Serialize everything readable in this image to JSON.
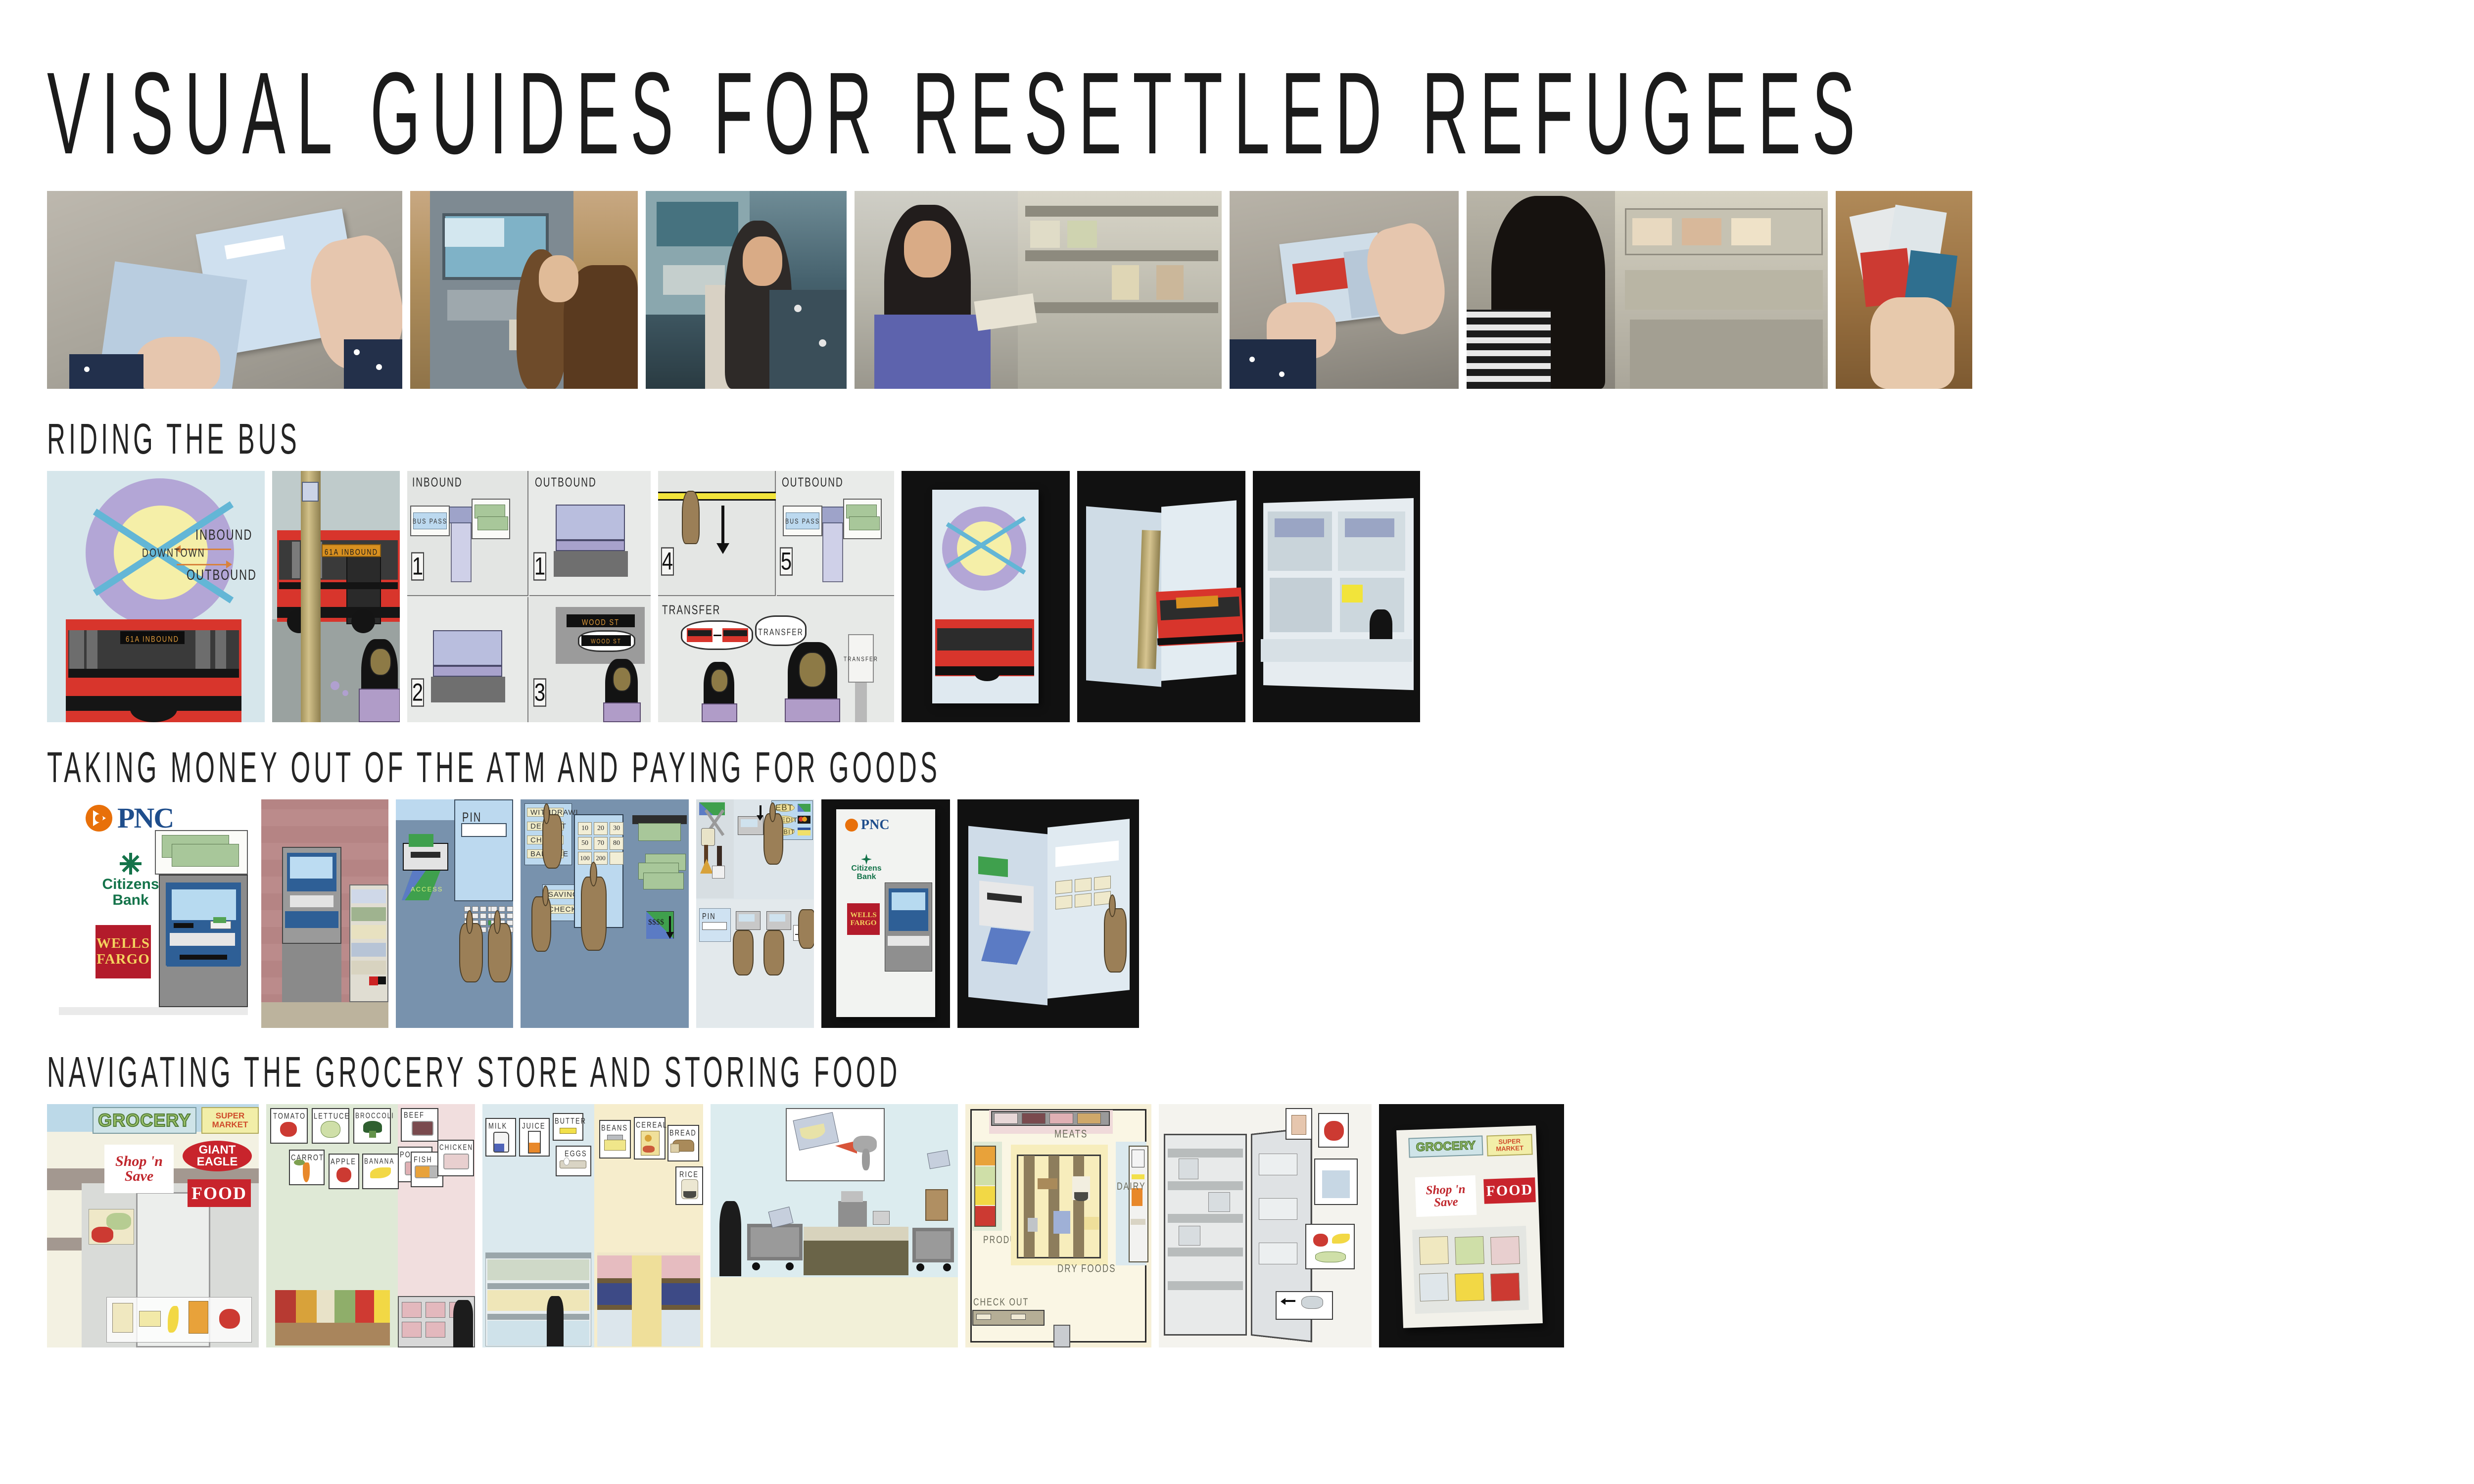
{
  "title": "VISUAL GUIDES FOR RESETTLED REFUGEES",
  "photo_strip": [
    {
      "caption": "hands holding open atm pop-up booklet on sidewalk"
    },
    {
      "caption": "woman using atm machine keypad"
    },
    {
      "caption": "woman on bus holding guide near farebox"
    },
    {
      "caption": "woman reading guide in grocery aisle"
    },
    {
      "caption": "hands holding bus pop-up booklet outdoors"
    },
    {
      "caption": "woman at grocery deli counter"
    },
    {
      "caption": "hands holding stack of guide cards on wood table"
    }
  ],
  "sections": [
    {
      "id": "bus",
      "heading": "RIDING THE BUS",
      "panels": [
        {
          "id": "bus-map",
          "kind": "illustration",
          "labels": [
            "INBOUND",
            "OUTBOUND",
            "DOWNTOWN"
          ],
          "bus_sign": "61A INBOUND"
        },
        {
          "id": "bus-stop",
          "kind": "illustration",
          "bus_sign": "61A INBOUND"
        },
        {
          "id": "board-steps",
          "kind": "illustration",
          "headers": [
            "INBOUND",
            "OUTBOUND"
          ],
          "steps": [
            "1",
            "1",
            "2",
            "3"
          ],
          "signs": [
            "BUS PASS",
            "WOOD ST",
            "WOOD ST"
          ]
        },
        {
          "id": "transfer-steps",
          "kind": "illustration",
          "headers": [
            "OUTBOUND",
            "TRANSFER"
          ],
          "steps": [
            "4",
            "5"
          ],
          "signs": [
            "BUS PASS",
            "TRANSFER",
            "TRANSFER"
          ]
        },
        {
          "id": "bus-book-cover",
          "kind": "photo",
          "caption": "bus guide cover on black"
        },
        {
          "id": "bus-book-open",
          "kind": "photo",
          "caption": "bus pop-up open on black"
        },
        {
          "id": "bus-book-spread",
          "kind": "photo",
          "caption": "bus guide full spread on black"
        }
      ]
    },
    {
      "id": "atm",
      "heading": "TAKING MONEY OUT OF THE ATM AND PAYING FOR GOODS",
      "panels": [
        {
          "id": "banks",
          "kind": "illustration",
          "bank_logos": [
            "PNC",
            "Citizens Bank",
            "WELLS FARGO"
          ]
        },
        {
          "id": "atm-exterior",
          "kind": "illustration"
        },
        {
          "id": "pin-entry",
          "kind": "illustration",
          "labels": [
            "PIN",
            "ACCESS"
          ],
          "keypad_keys": [
            "1",
            "2",
            "3",
            "X",
            "4",
            "5",
            "6",
            "",
            "7",
            "8",
            "9",
            "O",
            "",
            "0",
            "",
            ""
          ]
        },
        {
          "id": "withdraw",
          "kind": "illustration",
          "menu_primary": [
            "WITHDRAWL",
            "DEPOSIT",
            "CHECK",
            "BALANCE"
          ],
          "menu_account": [
            "SAVINGS",
            "CHECKING"
          ],
          "denominations": [
            "10",
            "20",
            "30",
            "50",
            "70",
            "80",
            "100",
            "200"
          ],
          "cash_icon": "$$$$"
        },
        {
          "id": "paying",
          "kind": "illustration",
          "payment_options": [
            "EBT",
            "CREDIT",
            "DEBIT"
          ],
          "labels": [
            "PIN"
          ]
        },
        {
          "id": "atm-book-cover",
          "kind": "photo",
          "caption": "atm guide cover on black",
          "bank_logos": [
            "PNC",
            "Citizens Bank",
            "WELLS FARGO"
          ]
        },
        {
          "id": "atm-book-open",
          "kind": "photo",
          "caption": "atm pop-up open on black"
        }
      ]
    },
    {
      "id": "grocery",
      "heading": "NAVIGATING THE GROCERY STORE AND STORING FOOD",
      "panels": [
        {
          "id": "storefront",
          "kind": "illustration",
          "store_signs": [
            "GROCERY",
            "SUPER MARKET",
            "Shop 'n Save",
            "GIANT EAGLE",
            "FOOD"
          ]
        },
        {
          "id": "produce-meat",
          "kind": "illustration",
          "produce_labels": [
            "TOMATO",
            "LETTUCE",
            "BROCCOLI",
            "CARROT",
            "APPLE",
            "BANANA"
          ],
          "meat_labels": [
            "BEEF",
            "PORK",
            "FISH",
            "CHICKEN"
          ]
        },
        {
          "id": "dairy-dry",
          "kind": "illustration",
          "dairy_labels": [
            "MILK",
            "JUICE",
            "BUTTER",
            "EGGS"
          ],
          "dry_labels": [
            "BEANS",
            "CEREAL",
            "BREAD",
            "RICE"
          ]
        },
        {
          "id": "checkout",
          "kind": "illustration"
        },
        {
          "id": "store-map",
          "kind": "illustration",
          "map_labels": [
            "MEATS",
            "PRODUCE",
            "DRY FOODS",
            "DAIRY",
            "CHECK OUT"
          ]
        },
        {
          "id": "fridge",
          "kind": "illustration"
        },
        {
          "id": "grocery-book",
          "kind": "photo",
          "caption": "grocery guide cards on black",
          "store_signs": [
            "GROCERY",
            "SUPER MARKET",
            "Shop 'n Save",
            "FOOD"
          ]
        }
      ]
    }
  ],
  "colors": {
    "pnc_orange": "#E8700A",
    "pnc_blue": "#1F4E8C",
    "citizens_green": "#14734A",
    "wells_red": "#B31B2B",
    "wells_gold": "#F4D35E",
    "bus_red": "#D8352C",
    "inbound_purple": "#B3A6D6",
    "downtown_yellow": "#F5EFA8",
    "sky_blue": "#D6E6EB",
    "atm_slate": "#7892AD",
    "giant_eagle_red": "#C8242C"
  }
}
